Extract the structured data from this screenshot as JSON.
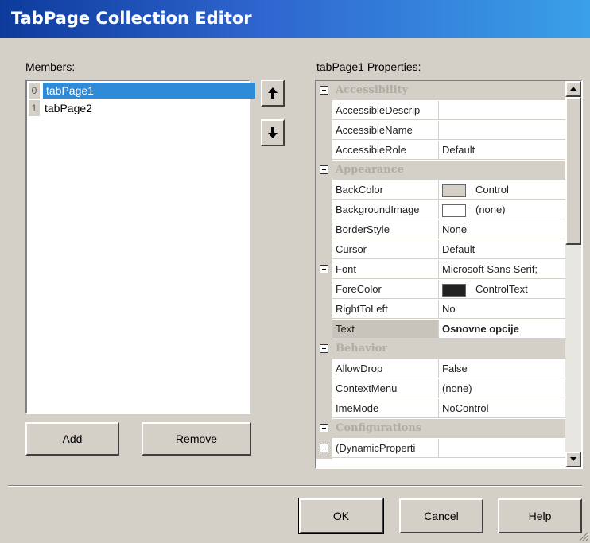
{
  "window": {
    "title": "TabPage Collection Editor"
  },
  "members": {
    "label": "Members:",
    "items": [
      {
        "index": "0",
        "name": "tabPage1",
        "selected": true
      },
      {
        "index": "1",
        "name": "tabPage2",
        "selected": false
      }
    ],
    "add_label": "Add",
    "remove_label": "Remove"
  },
  "properties": {
    "label": "tabPage1 Properties:",
    "categories": {
      "accessibility": "Accessibility",
      "appearance": "Appearance",
      "behavior": "Behavior",
      "configurations": "Configurations"
    },
    "rows": {
      "accessible_description": {
        "name": "AccessibleDescrip",
        "value": ""
      },
      "accessible_name": {
        "name": "AccessibleName",
        "value": ""
      },
      "accessible_role": {
        "name": "AccessibleRole",
        "value": "Default"
      },
      "back_color": {
        "name": "BackColor",
        "value": "Control",
        "color": "#d4d0c8"
      },
      "background_image": {
        "name": "BackgroundImage",
        "value": "(none)",
        "color": "#ffffff"
      },
      "border_style": {
        "name": "BorderStyle",
        "value": "None"
      },
      "cursor": {
        "name": "Cursor",
        "value": "Default"
      },
      "font": {
        "name": "Font",
        "value": "Microsoft Sans Serif;"
      },
      "fore_color": {
        "name": "ForeColor",
        "value": "ControlText",
        "color": "#222222"
      },
      "right_to_left": {
        "name": "RightToLeft",
        "value": "No"
      },
      "text": {
        "name": "Text",
        "value": "Osnovne opcije"
      },
      "allow_drop": {
        "name": "AllowDrop",
        "value": "False"
      },
      "context_menu": {
        "name": "ContextMenu",
        "value": "(none)"
      },
      "ime_mode": {
        "name": "ImeMode",
        "value": "NoControl"
      },
      "dynamic_properties": {
        "name": "(DynamicProperti",
        "value": ""
      }
    }
  },
  "footer": {
    "ok_label": "OK",
    "cancel_label": "Cancel",
    "help_label": "Help"
  },
  "colors": {
    "title_start": "#0d3b9c",
    "title_end": "#3aa0e8",
    "selection": "#2f8ad7",
    "face": "#d4d0c8"
  }
}
